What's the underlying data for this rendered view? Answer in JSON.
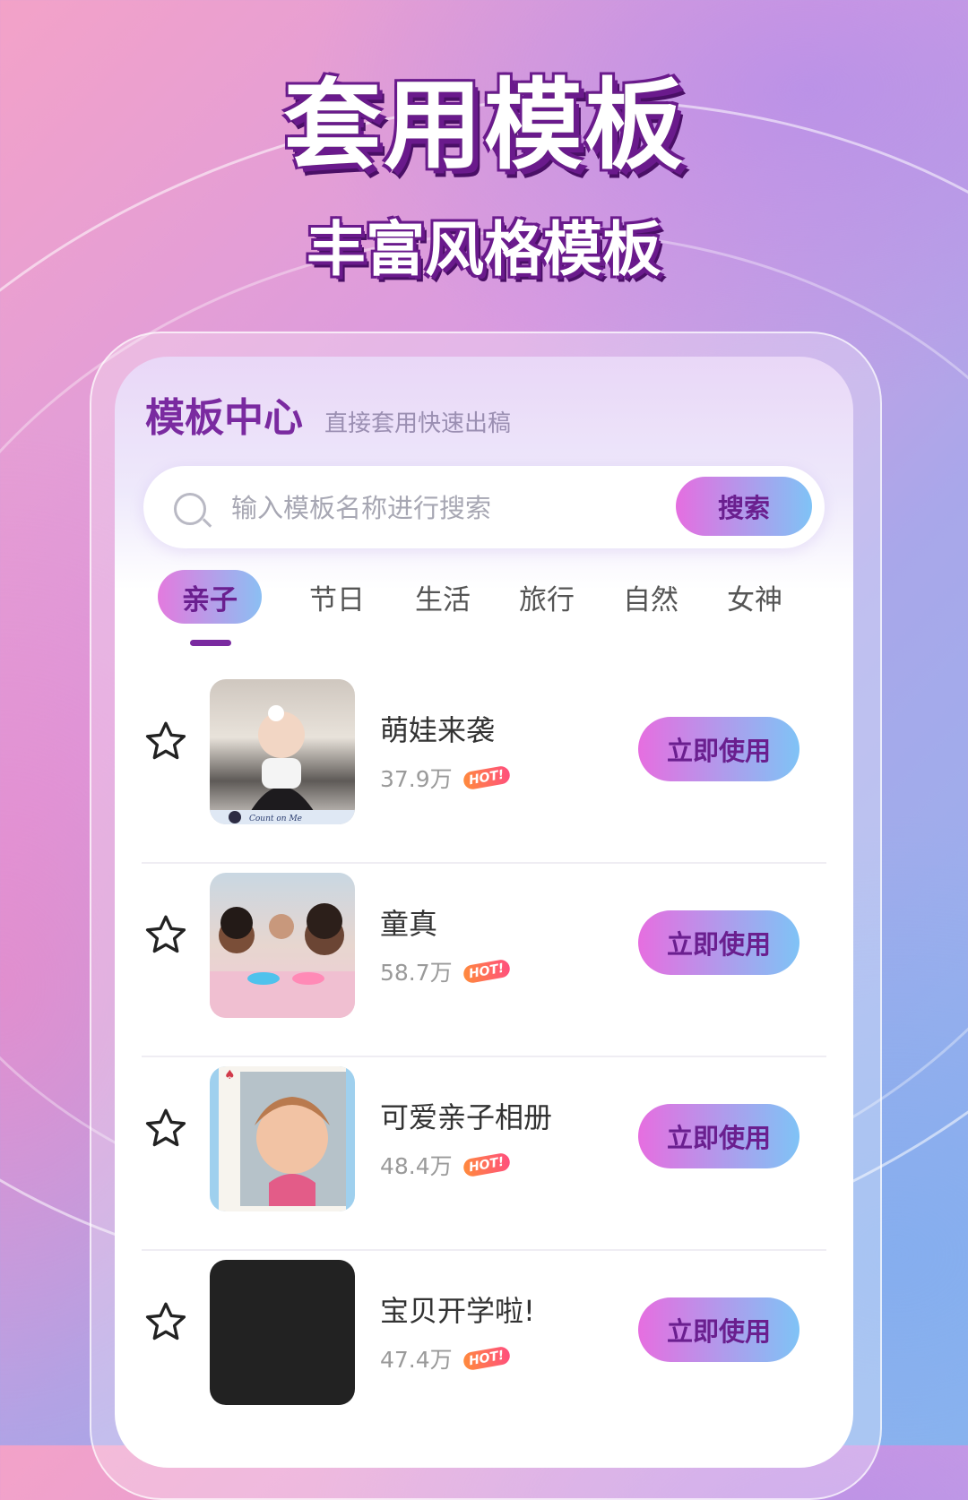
{
  "hero": {
    "title": "套用模板",
    "subtitle": "丰富风格模板"
  },
  "header": {
    "title": "模板中心",
    "subtitle": "直接套用快速出稿"
  },
  "search": {
    "placeholder": "输入模板名称进行搜索",
    "button": "搜索"
  },
  "tabs": [
    {
      "label": "亲子"
    },
    {
      "label": "节日"
    },
    {
      "label": "生活"
    },
    {
      "label": "旅行"
    },
    {
      "label": "自然"
    },
    {
      "label": "女神"
    }
  ],
  "templates": [
    {
      "name": "萌娃来袭",
      "count": "37.9万",
      "hot": "HOT!",
      "action": "立即使用"
    },
    {
      "name": "童真",
      "count": "58.7万",
      "hot": "HOT!",
      "action": "立即使用"
    },
    {
      "name": "可爱亲子相册",
      "count": "48.4万",
      "hot": "HOT!",
      "action": "立即使用"
    },
    {
      "name": "宝贝开学啦!",
      "count": "47.4万",
      "hot": "HOT!",
      "action": "立即使用"
    }
  ],
  "thumb_caption": "Count on Me",
  "colors": {
    "accent": "#7a2aa0",
    "button_start": "#e66ee0",
    "button_end": "#7fc3f6"
  }
}
